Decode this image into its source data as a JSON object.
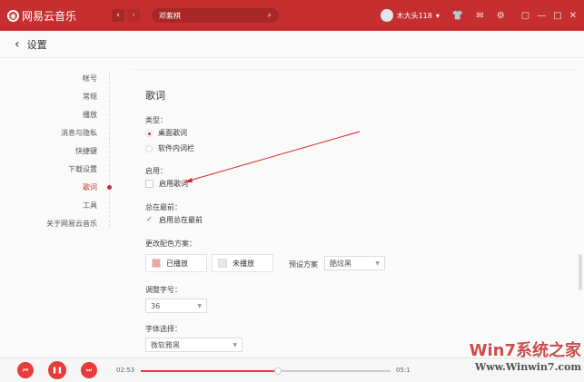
{
  "app": {
    "title": "网易云音乐",
    "logo_glyph": "◉",
    "back": "‹",
    "forward": "›"
  },
  "search": {
    "value": "邓紫棋",
    "icon": "⌕"
  },
  "user": {
    "name": "木大头118",
    "caret": "▾"
  },
  "toolbar_icons": [
    "👕",
    "✉",
    "⚙"
  ],
  "window_controls": [
    "▢",
    "—",
    "□",
    "✕"
  ],
  "header": {
    "back": "‹",
    "title": "设置"
  },
  "sidebar": {
    "items": [
      {
        "label": "帐号"
      },
      {
        "label": "常规"
      },
      {
        "label": "播放"
      },
      {
        "label": "消息与隐私"
      },
      {
        "label": "快捷键"
      },
      {
        "label": "下载设置"
      },
      {
        "label": "歌词",
        "active": true
      },
      {
        "label": "工具"
      },
      {
        "label": "关于网易云音乐"
      }
    ]
  },
  "lyrics": {
    "title": "歌词",
    "type_label": "类型：",
    "type_options": [
      {
        "label": "桌面歌词",
        "selected": true
      },
      {
        "label": "软件内词栏",
        "selected": false
      }
    ],
    "enable_label": "启用：",
    "enable_option": {
      "label": "启用歌词",
      "checked": false
    },
    "ontop_label": "总在最前：",
    "ontop_option": {
      "label": "启用总在最前",
      "checked": true,
      "mark": "✓"
    },
    "color_label": "更改配色方案：",
    "played_label": "已播放",
    "played_color": "#f4a3a3",
    "unplayed_label": "未播放",
    "unplayed_color": "#e8e8e8",
    "preset_label": "预设方案",
    "preset_value": "酷炫黑",
    "size_label": "调整字号：",
    "size_value": "36",
    "font_label": "字体选择：",
    "font_value": "微软雅黑",
    "caret": "▼"
  },
  "player": {
    "prev": "⏮",
    "pause": "❚❚",
    "next": "⏭",
    "current": "02:53",
    "total": "05:1",
    "progress": 0.55
  },
  "watermark": {
    "text": "Win7系统之家",
    "url": "Www.Winwin7.com"
  }
}
